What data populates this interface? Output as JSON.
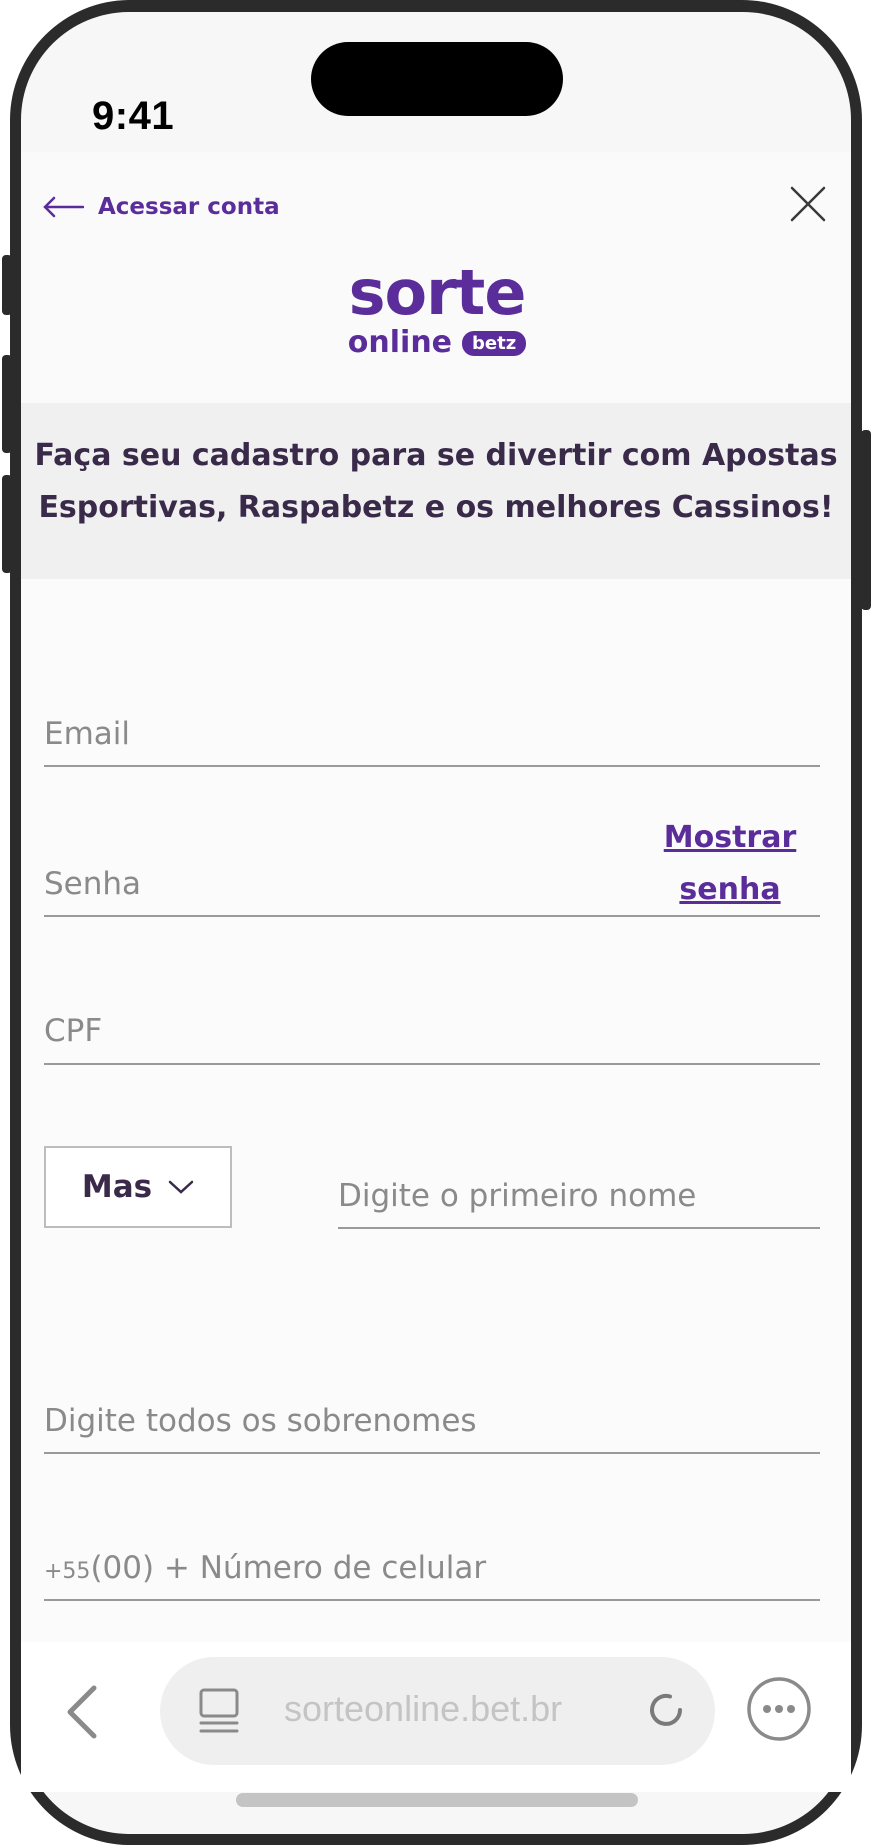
{
  "status_bar": {
    "time": "9:41"
  },
  "header": {
    "back_label": "Acessar conta",
    "logo": {
      "line1": "sorte",
      "line2": "online",
      "badge": "betz"
    }
  },
  "banner": {
    "text": "Faça seu cadastro para se divertir com Apostas Esportivas, Raspabetz e os melhores Cassinos!"
  },
  "form": {
    "email_placeholder": "Email",
    "password_placeholder": "Senha",
    "show_password_label": "Mostrar senha",
    "cpf_placeholder": "CPF",
    "gender_value": "Mas",
    "first_name_placeholder": "Digite o primeiro nome",
    "last_name_placeholder": "Digite todos os sobrenomes",
    "phone_prefix": "+55",
    "phone_placeholder": "(00) + Número de celular"
  },
  "browser": {
    "url": "sorteonline.bet.br"
  },
  "colors": {
    "brand": "#5b2d9a",
    "text_dark": "#3a2a4a",
    "placeholder": "#8a8a8a"
  },
  "icons": [
    "arrow-left-icon",
    "close-icon",
    "chevron-down-icon",
    "chevron-left-icon",
    "tabs-icon",
    "reload-icon",
    "more-icon"
  ]
}
